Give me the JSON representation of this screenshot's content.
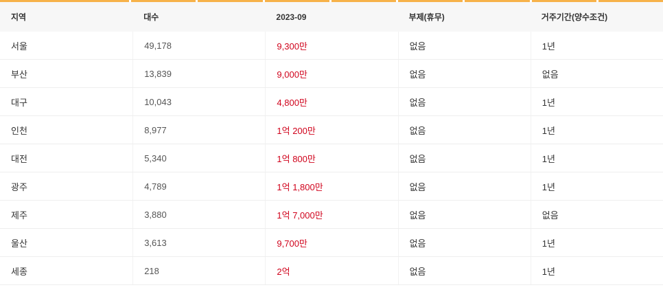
{
  "table": {
    "headers": {
      "region": "지역",
      "count": "대수",
      "price": "2023-09",
      "rotation": "부제(휴무)",
      "residence": "거주기간(양수조건)"
    },
    "rows": [
      {
        "region": "서울",
        "count": "49,178",
        "price": "9,300만",
        "rotation": "없음",
        "residence": "1년"
      },
      {
        "region": "부산",
        "count": "13,839",
        "price": "9,000만",
        "rotation": "없음",
        "residence": "없음"
      },
      {
        "region": "대구",
        "count": "10,043",
        "price": "4,800만",
        "rotation": "없음",
        "residence": "1년"
      },
      {
        "region": "인천",
        "count": "8,977",
        "price": "1억 200만",
        "rotation": "없음",
        "residence": "1년"
      },
      {
        "region": "대전",
        "count": "5,340",
        "price": "1억 800만",
        "rotation": "없음",
        "residence": "1년"
      },
      {
        "region": "광주",
        "count": "4,789",
        "price": "1억 1,800만",
        "rotation": "없음",
        "residence": "1년"
      },
      {
        "region": "제주",
        "count": "3,880",
        "price": "1억 7,000만",
        "rotation": "없음",
        "residence": "없음"
      },
      {
        "region": "울산",
        "count": "3,613",
        "price": "9,700만",
        "rotation": "없음",
        "residence": "1년"
      },
      {
        "region": "세종",
        "count": "218",
        "price": "2억",
        "rotation": "없음",
        "residence": "1년"
      }
    ]
  },
  "colors": {
    "accent": "#f7b24a",
    "price": "#d0021b",
    "header_bg": "#f7f7f7",
    "text": "#333333",
    "muted": "#555555"
  }
}
